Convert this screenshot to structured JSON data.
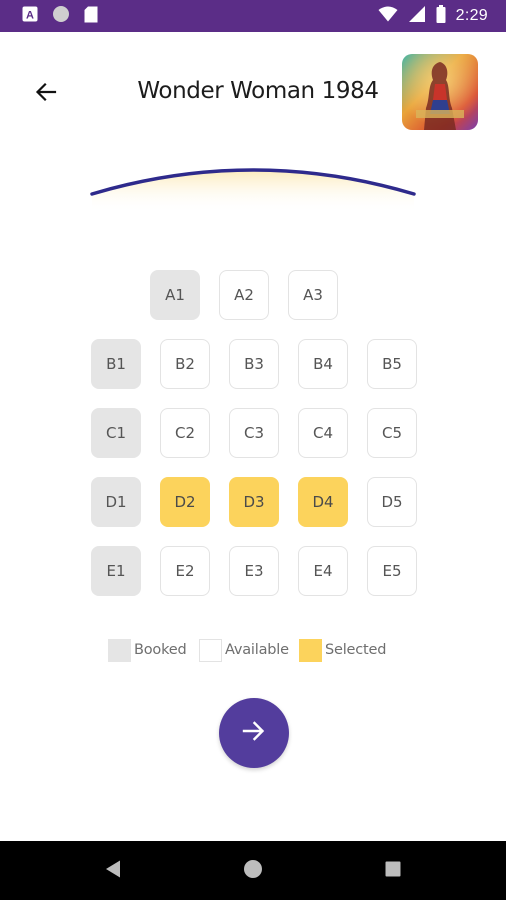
{
  "status_bar": {
    "time": "2:29",
    "icons": [
      "app-a-icon",
      "circle-icon",
      "sd-card-icon",
      "wifi-icon",
      "signal-icon",
      "battery-icon"
    ],
    "background": "#5b2d87"
  },
  "header": {
    "back_icon": "arrow-left-icon",
    "title": "Wonder Woman 1984",
    "poster_alt": "poster-image"
  },
  "seats": [
    {
      "id": "A1",
      "state": "booked"
    },
    {
      "id": "A2",
      "state": "available"
    },
    {
      "id": "A3",
      "state": "available"
    },
    {
      "id": "B1",
      "state": "booked"
    },
    {
      "id": "B2",
      "state": "available"
    },
    {
      "id": "B3",
      "state": "available"
    },
    {
      "id": "B4",
      "state": "available"
    },
    {
      "id": "B5",
      "state": "available"
    },
    {
      "id": "C1",
      "state": "booked"
    },
    {
      "id": "C2",
      "state": "available"
    },
    {
      "id": "C3",
      "state": "available"
    },
    {
      "id": "C4",
      "state": "available"
    },
    {
      "id": "C5",
      "state": "available"
    },
    {
      "id": "D1",
      "state": "booked"
    },
    {
      "id": "D2",
      "state": "selected"
    },
    {
      "id": "D3",
      "state": "selected"
    },
    {
      "id": "D4",
      "state": "selected"
    },
    {
      "id": "D5",
      "state": "available"
    },
    {
      "id": "E1",
      "state": "booked"
    },
    {
      "id": "E2",
      "state": "available"
    },
    {
      "id": "E3",
      "state": "available"
    },
    {
      "id": "E4",
      "state": "available"
    },
    {
      "id": "E5",
      "state": "available"
    }
  ],
  "legend": {
    "booked": "Booked",
    "available": "Available",
    "selected": "Selected"
  },
  "next_button": {
    "icon": "arrow-right-icon"
  },
  "colors": {
    "accent": "#533d9d",
    "selected": "#fcd35c",
    "booked": "#e5e5e5",
    "screen_line": "#2e2a8c"
  },
  "nav_bar": {
    "icons": [
      "back-triangle-icon",
      "home-circle-icon",
      "recents-square-icon"
    ]
  }
}
